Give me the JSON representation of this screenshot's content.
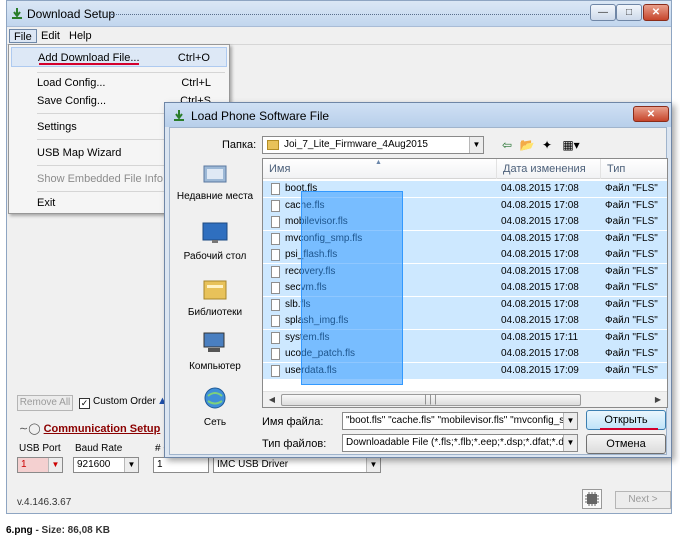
{
  "main_window": {
    "title": "Download Setup",
    "menu": [
      "File",
      "Edit",
      "Help"
    ],
    "file_menu": [
      {
        "label": "Add Download File...",
        "shortcut": "Ctrl+O"
      },
      {
        "label": "Load Config...",
        "shortcut": "Ctrl+L"
      },
      {
        "label": "Save Config...",
        "shortcut": "Ctrl+S"
      },
      {
        "label": "Settings",
        "shortcut": ""
      },
      {
        "label": "USB Map Wizard",
        "shortcut": ""
      },
      {
        "label": "Show Embedded File Info",
        "shortcut": ""
      },
      {
        "label": "Exit",
        "shortcut": ""
      }
    ],
    "remove_all": "Remove All",
    "custom_order": "Custom Order",
    "comm_setup": "Communication Setup",
    "usb_port_label": "USB Port",
    "usb_port_value": "1",
    "baud_rate_label": "Baud Rate",
    "baud_rate_value": "921600",
    "hash_label": "# C",
    "hash_value": "1",
    "driver_value": "IMC USB Driver",
    "version": "v.4.146.3.67",
    "next_button": "Next >"
  },
  "dialog": {
    "title": "Load Phone Software File",
    "folder_label": "Папка:",
    "folder_value": "Joi_7_Lite_Firmware_4Aug2015",
    "places": [
      "Недавние места",
      "Рабочий стол",
      "Библиотеки",
      "Компьютер",
      "Сеть"
    ],
    "columns": [
      "Имя",
      "Дата изменения",
      "Тип"
    ],
    "files": [
      {
        "name": "boot.fls",
        "date": "04.08.2015 17:08",
        "type": "Файл \"FLS\""
      },
      {
        "name": "cache.fls",
        "date": "04.08.2015 17:08",
        "type": "Файл \"FLS\""
      },
      {
        "name": "mobilevisor.fls",
        "date": "04.08.2015 17:08",
        "type": "Файл \"FLS\""
      },
      {
        "name": "mvconfig_smp.fls",
        "date": "04.08.2015 17:08",
        "type": "Файл \"FLS\""
      },
      {
        "name": "psi_flash.fls",
        "date": "04.08.2015 17:08",
        "type": "Файл \"FLS\""
      },
      {
        "name": "recovery.fls",
        "date": "04.08.2015 17:08",
        "type": "Файл \"FLS\""
      },
      {
        "name": "secvm.fls",
        "date": "04.08.2015 17:08",
        "type": "Файл \"FLS\""
      },
      {
        "name": "slb.fls",
        "date": "04.08.2015 17:08",
        "type": "Файл \"FLS\""
      },
      {
        "name": "splash_img.fls",
        "date": "04.08.2015 17:08",
        "type": "Файл \"FLS\""
      },
      {
        "name": "system.fls",
        "date": "04.08.2015 17:11",
        "type": "Файл \"FLS\""
      },
      {
        "name": "ucode_patch.fls",
        "date": "04.08.2015 17:08",
        "type": "Файл \"FLS\""
      },
      {
        "name": "userdata.fls",
        "date": "04.08.2015 17:09",
        "type": "Файл \"FLS\""
      }
    ],
    "filename_label": "Имя файла:",
    "filename_value": "\"boot.fls\" \"cache.fls\" \"mobilevisor.fls\" \"mvconfig_smp",
    "filetype_label": "Тип файлов:",
    "filetype_value": "Downloadable File (*.fls;*.flb;*.eep;*.dsp;*.dfat;*.dffs;*.",
    "open_button": "Открыть",
    "cancel_button": "Отмена"
  },
  "caption": {
    "name": "6.png",
    "rest": " - Size: 86,08 KB"
  }
}
